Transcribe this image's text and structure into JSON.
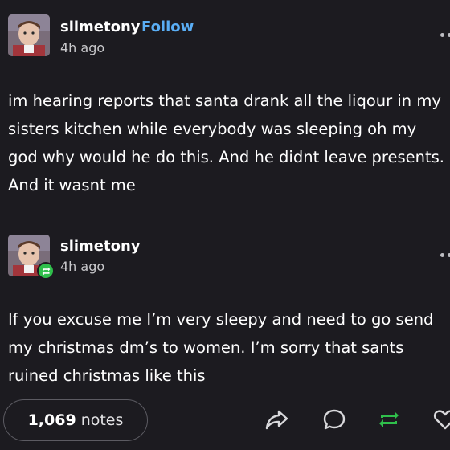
{
  "posts": [
    {
      "username": "slimetony",
      "follow_label": "Follow",
      "time": "4h ago",
      "avatar_icon": "avatar-photo",
      "body": "im hearing reports that santa drank all the liqour in my sisters kitchen while everybody was sleeping oh my god why would he do this. And he didnt leave presents. And it wasnt me"
    },
    {
      "username": "slimetony",
      "time": "4h ago",
      "avatar_icon": "avatar-photo",
      "badge_icon": "reblog-icon",
      "body": "If you excuse me I’m very sleepy and need to go send my christmas dm’s to women. I’m sorry that sants ruined christmas like this"
    }
  ],
  "footer": {
    "notes_count": "1,069",
    "notes_label": "notes",
    "actions": [
      "share-icon",
      "reply-icon",
      "reblog-icon",
      "like-icon"
    ]
  },
  "colors": {
    "background": "#1c1b20",
    "follow": "#5aaef5",
    "reblog_active": "#2fbf4b",
    "text": "#ffffff",
    "muted": "#c9c9cc"
  }
}
